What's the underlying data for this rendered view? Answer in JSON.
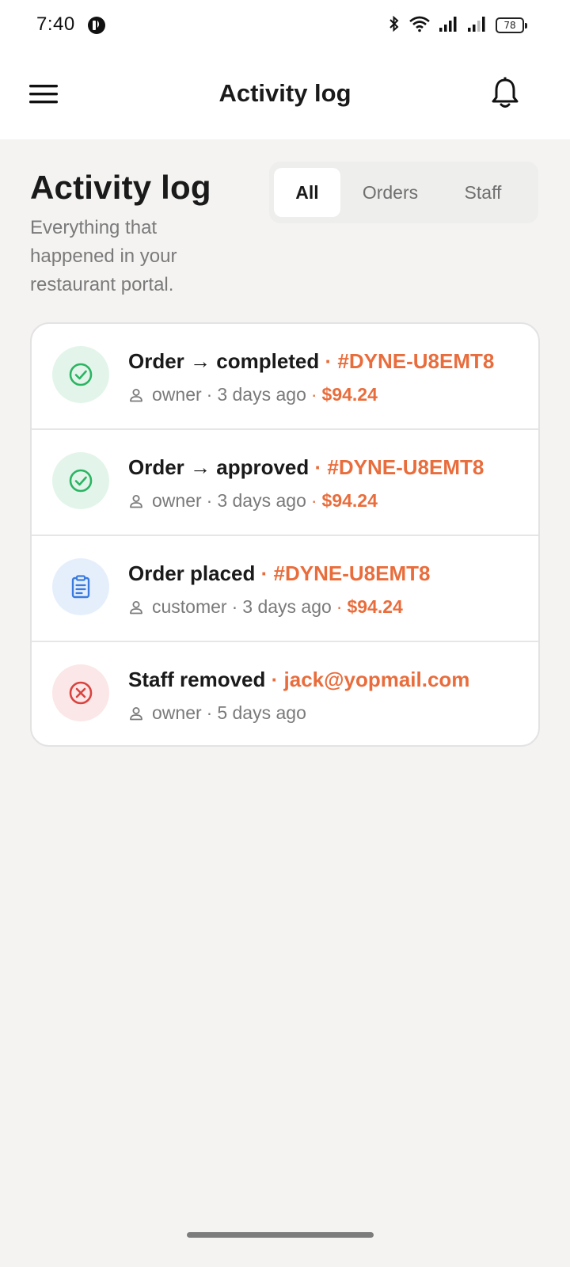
{
  "status_bar": {
    "time": "7:40",
    "battery_level": "78",
    "icons": [
      "app-notification-icon",
      "bluetooth-icon",
      "wifi-icon",
      "signal-icon",
      "signal-weak-icon",
      "battery-icon"
    ]
  },
  "app_bar": {
    "title": "Activity log",
    "menu_icon": "hamburger-menu-icon",
    "notification_icon": "bell-icon"
  },
  "header": {
    "title": "Activity log",
    "subtitle": "Everything that happened in your restaurant portal."
  },
  "tabs": [
    {
      "label": "All",
      "active": true
    },
    {
      "label": "Orders",
      "active": false
    },
    {
      "label": "Staff",
      "active": false
    }
  ],
  "activities": [
    {
      "icon": "check-circle-icon",
      "tone": "green",
      "title": "Order → completed",
      "sep": "·",
      "ref": "#DYNE-U8EMT8",
      "actor": "owner",
      "time": "3 days ago",
      "amount": "$94.24"
    },
    {
      "icon": "check-circle-icon",
      "tone": "green",
      "title": "Order → approved",
      "sep": "·",
      "ref": "#DYNE-U8EMT8",
      "actor": "owner",
      "time": "3 days ago",
      "amount": "$94.24"
    },
    {
      "icon": "clipboard-icon",
      "tone": "blue",
      "title": "Order placed",
      "sep": "·",
      "ref": "#DYNE-U8EMT8",
      "actor": "customer",
      "time": "3 days ago",
      "amount": "$94.24"
    },
    {
      "icon": "x-circle-icon",
      "tone": "red",
      "title": "Staff removed",
      "sep": "·",
      "ref": "jack@yopmail.com",
      "actor": "owner",
      "time": "5 days ago",
      "amount": ""
    }
  ],
  "colors": {
    "accent": "#e96d3c",
    "success": "#2bb463",
    "info": "#3a7be0",
    "danger": "#d9433f",
    "background": "#f4f3f2"
  }
}
